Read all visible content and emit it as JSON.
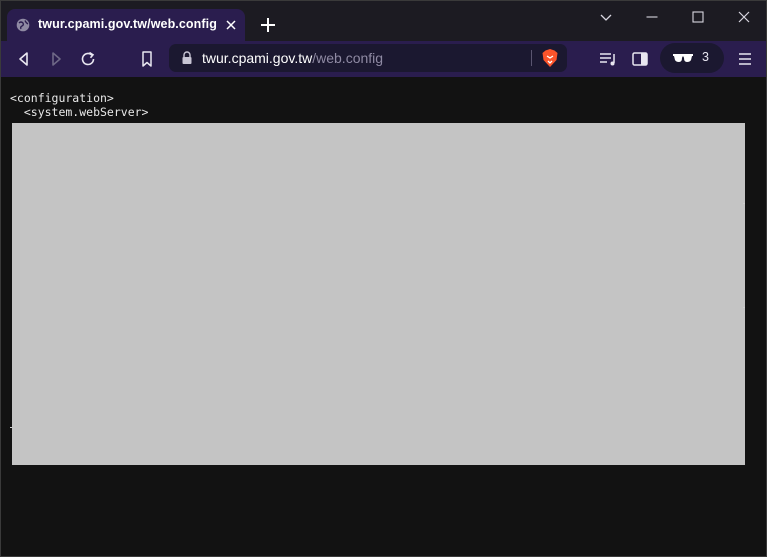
{
  "tab": {
    "title": "twur.cpami.gov.tw/web.config"
  },
  "address_bar": {
    "host": "twur.cpami.gov.tw",
    "path": "/web.config"
  },
  "private_window": {
    "count": "3"
  },
  "content": {
    "lines": [
      "<configuration>",
      "  <system.webServer>"
    ],
    "redacted_area_color": "#c4c4c4"
  },
  "colors": {
    "toolbar_bg": "#2a1d4e",
    "tabstrip_bg": "#1c1b22",
    "page_bg": "#121212",
    "brave_orange": "#fb542b"
  },
  "icons": {
    "tab_favicon": "globe-icon",
    "tab_close": "close-icon",
    "new_tab": "plus-icon",
    "back": "back-icon",
    "forward": "forward-icon",
    "reload": "reload-icon",
    "bookmark": "bookmark-icon",
    "lock": "lock-icon",
    "brave_shields": "brave-lion-icon",
    "playlist": "playlist-icon",
    "sidebar": "sidebar-icon",
    "private": "private-glasses-icon",
    "menu": "hamburger-menu-icon"
  }
}
